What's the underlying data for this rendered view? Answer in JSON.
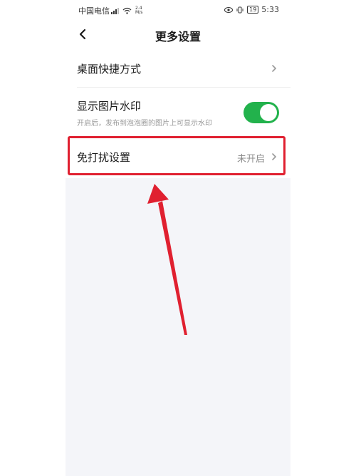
{
  "status_bar": {
    "carrier": "中国电信",
    "net_speed_value": "2.4",
    "net_speed_unit": "M/s",
    "battery": "19",
    "time": "5:33"
  },
  "nav": {
    "title": "更多设置"
  },
  "settings": {
    "shortcut": {
      "title": "桌面快捷方式"
    },
    "watermark": {
      "title": "显示图片水印",
      "subtitle": "开启后，发布到泡泡圈的图片上可显示水印",
      "enabled": true
    },
    "dnd": {
      "title": "免打扰设置",
      "value": "未开启"
    }
  },
  "colors": {
    "toggle_on": "#22b24c",
    "annotation_red": "#e02030"
  }
}
